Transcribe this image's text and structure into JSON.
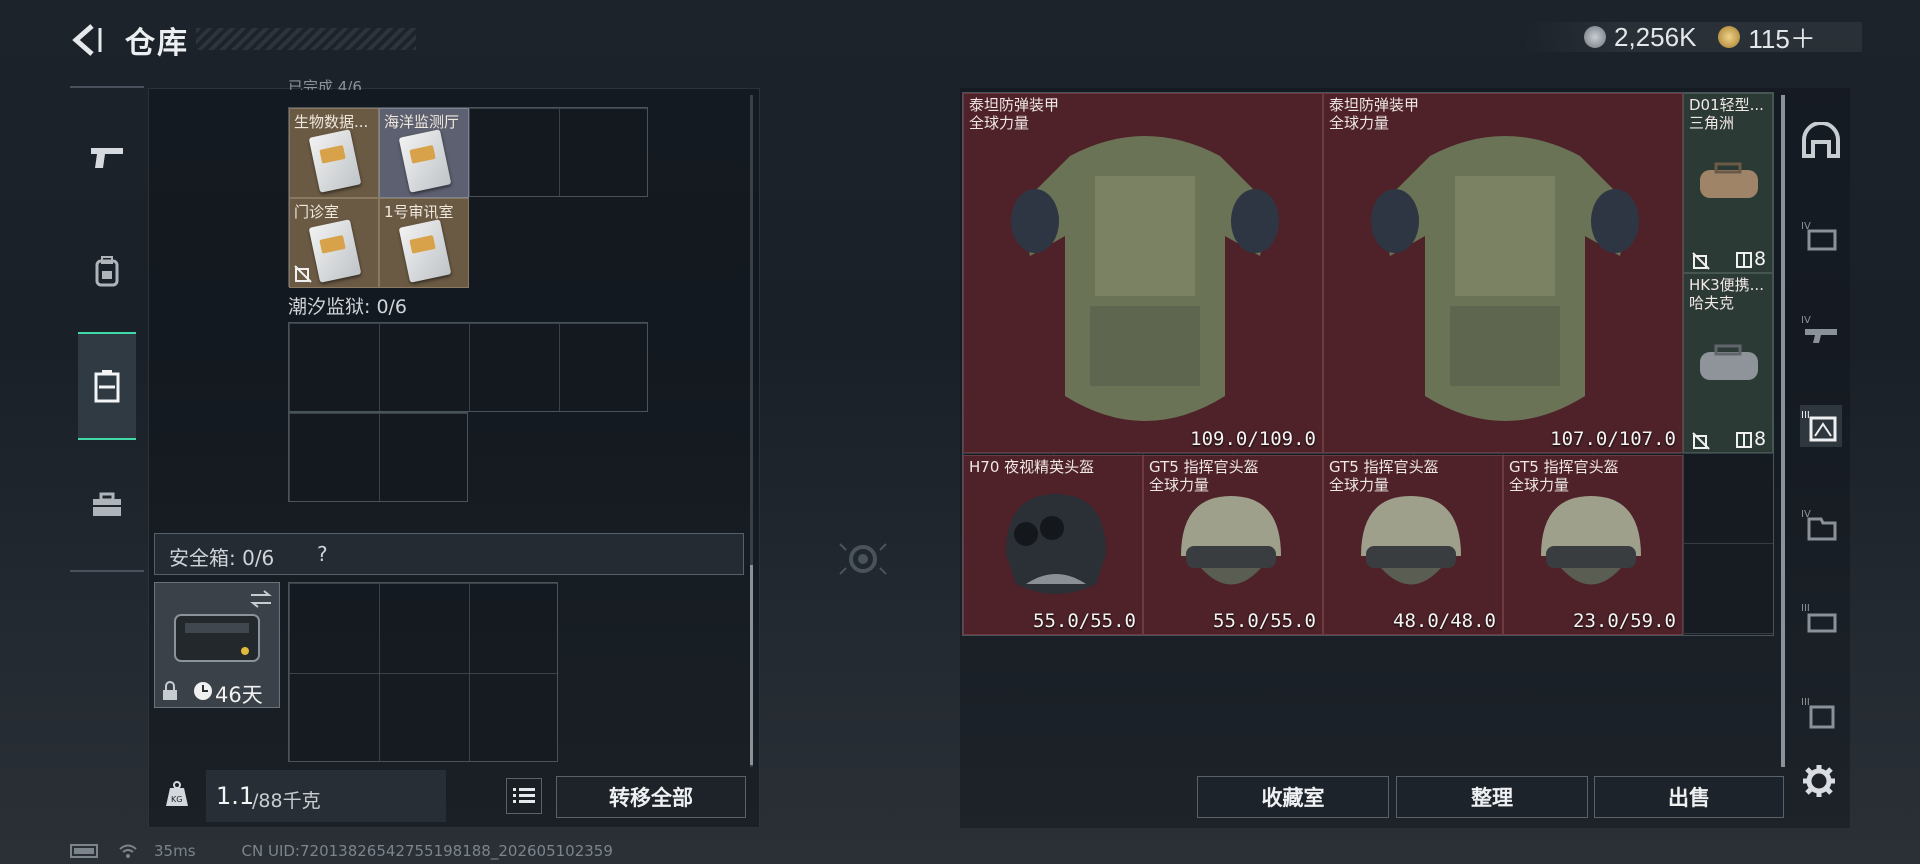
{
  "header": {
    "title": "仓库",
    "currency": [
      {
        "icon": "silver-coin-icon",
        "value": "2,256K"
      },
      {
        "icon": "gold-coin-icon",
        "value": "115＋"
      }
    ]
  },
  "left_nav": {
    "items": [
      {
        "icon": "pistol-icon"
      },
      {
        "icon": "backpack-icon"
      },
      {
        "icon": "storage-locker-icon",
        "active": true
      },
      {
        "icon": "toolbox-icon"
      }
    ]
  },
  "storage": {
    "partial_label": "已完成 4/6",
    "keycards": [
      {
        "label": "生物数据..."
      },
      {
        "label": "海洋监测厅"
      },
      {
        "label": "门诊室"
      },
      {
        "label": "1号审讯室"
      }
    ],
    "tide_prison_label": "潮汐监狱: 0/6",
    "safebox_label": "安全箱: 0/6",
    "safebox_help": "?",
    "safebox_days": "46天",
    "weight_current": "1.1",
    "weight_max": "/88千克",
    "transfer_all": "转移全部"
  },
  "inventory": {
    "items": [
      {
        "name": "泰坦防弹装甲",
        "faction": "全球力量",
        "durability": "109.0/109.0"
      },
      {
        "name": "泰坦防弹装甲",
        "faction": "全球力量",
        "durability": "107.0/107.0"
      },
      {
        "name": "D01轻型...",
        "faction": "三角洲",
        "count": "8"
      },
      {
        "name": "HK3便携...",
        "faction": "哈夫克",
        "count": "8"
      },
      {
        "name": "H70 夜视精英头盔",
        "faction": "",
        "durability": "55.0/55.0"
      },
      {
        "name": "GT5 指挥官头盔",
        "faction": "全球力量",
        "durability": "55.0/55.0"
      },
      {
        "name": "GT5 指挥官头盔",
        "faction": "全球力量",
        "durability": "48.0/48.0"
      },
      {
        "name": "GT5 指挥官头盔",
        "faction": "全球力量",
        "durability": "23.0/59.0"
      }
    ],
    "buttons": {
      "collection": "收藏室",
      "sort": "整理",
      "sell": "出售"
    }
  },
  "right_nav": {
    "items": [
      {
        "icon": "home-arch-icon"
      },
      {
        "icon": "tier4-gear-icon",
        "tier": "IV"
      },
      {
        "icon": "tier4-weapon-icon",
        "tier": "IV"
      },
      {
        "icon": "tier3-armor-icon",
        "tier": "III",
        "active": true
      },
      {
        "icon": "tier4-container-icon",
        "tier": "IV"
      },
      {
        "icon": "tier3-tool-icon",
        "tier": "III"
      },
      {
        "icon": "tier3-card-icon",
        "tier": "III"
      },
      {
        "icon": "settings-gear-icon"
      }
    ]
  },
  "footer": {
    "ping": "35ms",
    "uid": "CN UID:72013826542755198188_202605102359"
  },
  "colors": {
    "accent": "#3fd8a6",
    "item_red": "#4e2228",
    "item_green": "#2c3a36"
  }
}
